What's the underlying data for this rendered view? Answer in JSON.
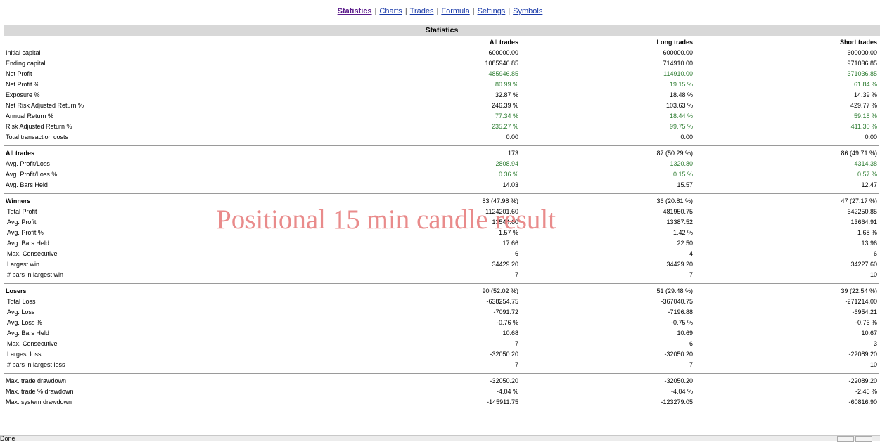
{
  "nav": {
    "items": [
      {
        "label": "Statistics",
        "active": true
      },
      {
        "label": "Charts"
      },
      {
        "label": "Trades"
      },
      {
        "label": "Formula"
      },
      {
        "label": "Settings"
      },
      {
        "label": "Symbols"
      }
    ],
    "separator": "|"
  },
  "header": {
    "title": "Statistics"
  },
  "columns": [
    "All trades",
    "Long trades",
    "Short trades"
  ],
  "summary": [
    {
      "label": "Initial capital",
      "values": [
        "600000.00",
        "600000.00",
        "600000.00"
      ]
    },
    {
      "label": "Ending capital",
      "values": [
        "1085946.85",
        "714910.00",
        "971036.85"
      ]
    },
    {
      "label": "Net Profit",
      "values": [
        "485946.85",
        "114910.00",
        "371036.85"
      ],
      "green": true
    },
    {
      "label": "Net Profit %",
      "values": [
        "80.99 %",
        "19.15 %",
        "61.84 %"
      ],
      "green": true
    },
    {
      "label": "Exposure %",
      "values": [
        "32.87 %",
        "18.48 %",
        "14.39 %"
      ]
    },
    {
      "label": "Net Risk Adjusted Return %",
      "values": [
        "246.39 %",
        "103.63 %",
        "429.77 %"
      ]
    },
    {
      "label": "Annual Return %",
      "values": [
        "77.34 %",
        "18.44 %",
        "59.18 %"
      ],
      "green": true
    },
    {
      "label": "Risk Adjusted Return %",
      "values": [
        "235.27 %",
        "99.75 %",
        "411.30 %"
      ],
      "green": true
    },
    {
      "label": "Total transaction costs",
      "values": [
        "0.00",
        "0.00",
        "0.00"
      ]
    }
  ],
  "all_trades": [
    {
      "label": "All trades",
      "values": [
        "173",
        "87 (50.29 %)",
        "86 (49.71 %)"
      ],
      "section": true
    },
    {
      "label": "Avg. Profit/Loss",
      "values": [
        "2808.94",
        "1320.80",
        "4314.38"
      ],
      "green": true
    },
    {
      "label": "Avg. Profit/Loss %",
      "values": [
        "0.36 %",
        "0.15 %",
        "0.57 %"
      ],
      "green": true
    },
    {
      "label": "Avg. Bars Held",
      "values": [
        "14.03",
        "15.57",
        "12.47"
      ]
    }
  ],
  "winners": [
    {
      "label": "Winners",
      "values": [
        "83 (47.98 %)",
        "36 (20.81 %)",
        "47 (27.17 %)"
      ],
      "section": true
    },
    {
      "label": "Total Profit",
      "values": [
        "1124201.60",
        "481950.75",
        "642250.85"
      ],
      "sub": true
    },
    {
      "label": "Avg. Profit",
      "values": [
        "13544.60",
        "13387.52",
        "13664.91"
      ],
      "sub": true
    },
    {
      "label": "Avg. Profit %",
      "values": [
        "1.57 %",
        "1.42 %",
        "1.68 %"
      ],
      "sub": true
    },
    {
      "label": "Avg. Bars Held",
      "values": [
        "17.66",
        "22.50",
        "13.96"
      ],
      "sub": true
    },
    {
      "label": "Max. Consecutive",
      "values": [
        "6",
        "4",
        "6"
      ],
      "sub": true
    },
    {
      "label": "Largest win",
      "values": [
        "34429.20",
        "34429.20",
        "34227.60"
      ],
      "sub": true
    },
    {
      "label": "# bars in largest win",
      "values": [
        "7",
        "7",
        "10"
      ],
      "sub": true
    }
  ],
  "losers": [
    {
      "label": "Losers",
      "values": [
        "90 (52.02 %)",
        "51 (29.48 %)",
        "39 (22.54 %)"
      ],
      "section": true
    },
    {
      "label": "Total Loss",
      "values": [
        "-638254.75",
        "-367040.75",
        "-271214.00"
      ],
      "sub": true
    },
    {
      "label": "Avg. Loss",
      "values": [
        "-7091.72",
        "-7196.88",
        "-6954.21"
      ],
      "sub": true
    },
    {
      "label": "Avg. Loss %",
      "values": [
        "-0.76 %",
        "-0.75 %",
        "-0.76 %"
      ],
      "sub": true
    },
    {
      "label": "Avg. Bars Held",
      "values": [
        "10.68",
        "10.69",
        "10.67"
      ],
      "sub": true
    },
    {
      "label": "Max. Consecutive",
      "values": [
        "7",
        "6",
        "3"
      ],
      "sub": true
    },
    {
      "label": "Largest loss",
      "values": [
        "-32050.20",
        "-32050.20",
        "-22089.20"
      ],
      "sub": true
    },
    {
      "label": "# bars in largest loss",
      "values": [
        "7",
        "7",
        "10"
      ],
      "sub": true
    }
  ],
  "drawdown": [
    {
      "label": "Max. trade drawdown",
      "values": [
        "-32050.20",
        "-32050.20",
        "-22089.20"
      ]
    },
    {
      "label": "Max. trade % drawdown",
      "values": [
        "-4.04 %",
        "-4.04 %",
        "-2.46 %"
      ]
    },
    {
      "label": "Max. system drawdown",
      "values": [
        "-145911.75",
        "-123279.05",
        "-60816.90"
      ]
    }
  ],
  "watermark": "Positional 15 min candle result",
  "status": {
    "text": "Done"
  },
  "colors": {
    "green": "#2e7d32",
    "link": "#1a3aa8",
    "active_link": "#5a1a8a",
    "header_bg": "#d8d8d8",
    "watermark": "#e88585"
  }
}
